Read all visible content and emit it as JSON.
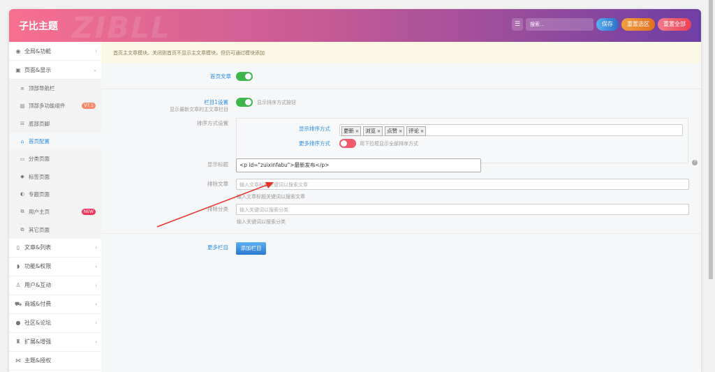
{
  "header": {
    "logo": "子比主题",
    "watermark": "ZIBLL",
    "search_placeholder": "搜索...",
    "save": "保存",
    "reset_section": "重置选区",
    "reset_all": "重置全部"
  },
  "sidebar": {
    "items": [
      {
        "label": "全局&功能",
        "icon": "circle-icon"
      },
      {
        "label": "页面&显示",
        "icon": "calendar-icon"
      },
      {
        "label": "文章&列表",
        "icon": "book-icon"
      },
      {
        "label": "功能&权限",
        "icon": "shield-icon"
      },
      {
        "label": "用户&互动",
        "icon": "user-icon"
      },
      {
        "label": "商城&付费",
        "icon": "cart-icon"
      },
      {
        "label": "社区&论坛",
        "icon": "globe-icon"
      },
      {
        "label": "扩展&增强",
        "icon": "puzzle-icon"
      },
      {
        "label": "主题&授权",
        "icon": "code-icon"
      }
    ],
    "subitems": [
      {
        "label": "顶部导航栏",
        "icon": "menu-icon"
      },
      {
        "label": "顶部多功能组件",
        "icon": "image-icon",
        "badge": "V7.1"
      },
      {
        "label": "底部页脚",
        "icon": "footer-icon"
      },
      {
        "label": "首页配置",
        "icon": "home-icon",
        "active": true
      },
      {
        "label": "分类页面",
        "icon": "folder-icon"
      },
      {
        "label": "标签页面",
        "icon": "tags-icon"
      },
      {
        "label": "专题页面",
        "icon": "cube-icon"
      },
      {
        "label": "用户主页",
        "icon": "copy-icon",
        "badge": "NEW"
      },
      {
        "label": "其它页面",
        "icon": "copy-icon"
      }
    ]
  },
  "main": {
    "notice": "首页主文章模块。关闭则首页不显示主文章模块，但仍可通过模块添加",
    "home_post_label": "首页文章",
    "column1_label": "栏目1设置",
    "column1_desc": "显示最新文章的主文章栏目",
    "column1_toggle_text": "显示排序方式按钮",
    "sort_settings_label": "排序方式设置",
    "show_sort_label": "显示排序方式",
    "sort_tags": [
      "更新",
      "浏览",
      "点赞",
      "评论"
    ],
    "more_sort_label": "更多排序方式",
    "more_sort_text": "用下拉框显示全部排序方式",
    "title_label": "显示标题",
    "title_value": "<p id=\"zuixinfabu\">最新发布</p>",
    "exclude_post_label": "排除文章",
    "exclude_post_placeholder": "输入文章标题关键词以搜索文章",
    "exclude_post_help": "输入文章标题关键词以搜索文章",
    "exclude_cat_label": "排除分类",
    "exclude_cat_placeholder": "输入关键词以搜索分类",
    "exclude_cat_help": "输入关键词以搜索分类",
    "more_columns_label": "更多栏目",
    "add_column": "添加栏目"
  },
  "colors": {
    "accent": "#2a8ee8",
    "toggle_on": "#3fb54a",
    "toggle_off": "#ef5b6b",
    "arrow": "#e8302a"
  }
}
